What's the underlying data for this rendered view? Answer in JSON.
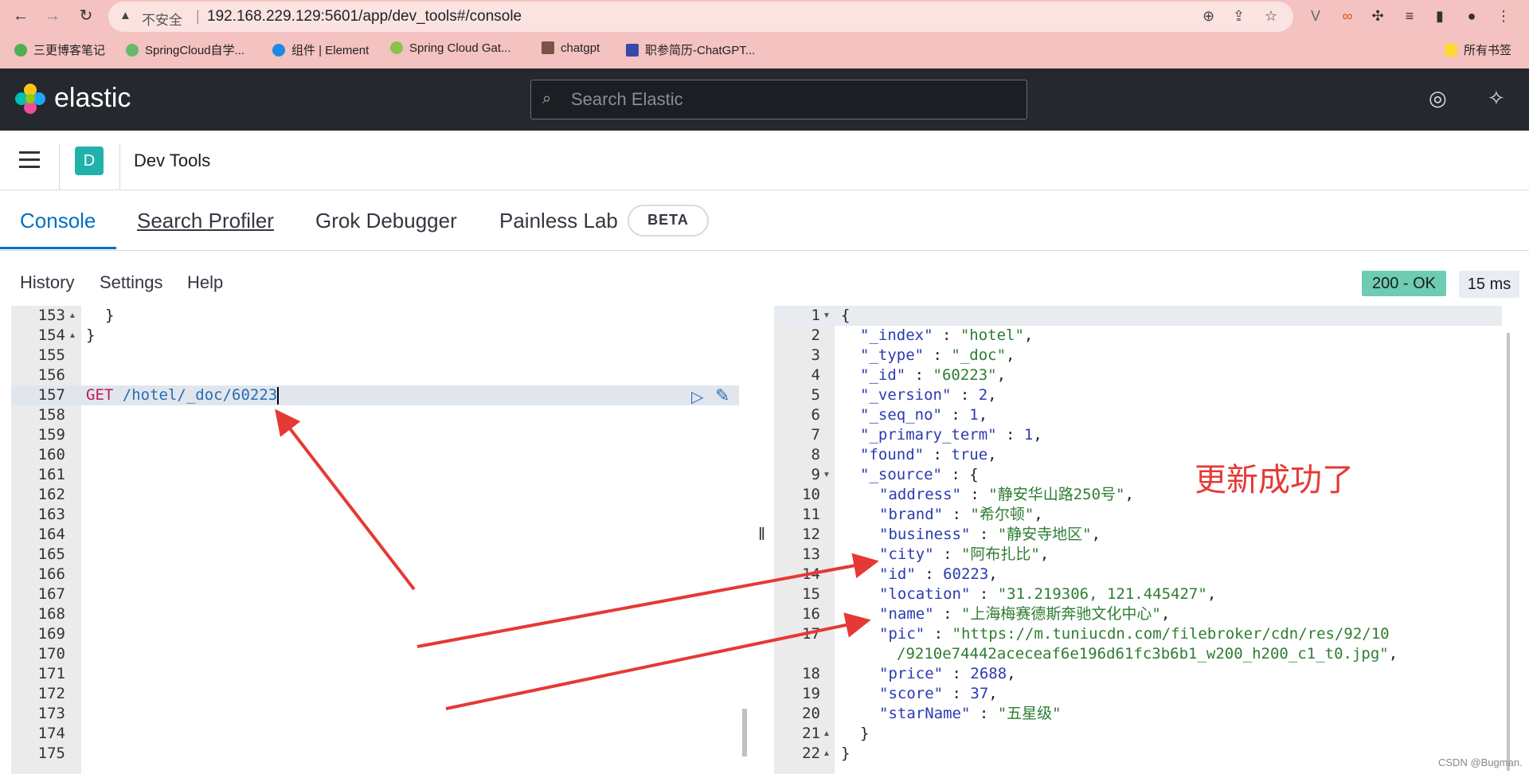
{
  "browser": {
    "insecure_label": "不安全",
    "url": "192.168.229.129:5601/app/dev_tools#/console",
    "bookmarks": [
      "三更博客笔记",
      "SpringCloud自学...",
      "组件 | Element",
      "Spring Cloud Gat...",
      "chatgpt",
      "职参简历-ChatGPT..."
    ],
    "all_bookmarks": "所有书签"
  },
  "header": {
    "brand": "elastic",
    "search_placeholder": "Search Elastic"
  },
  "breadcrumb": {
    "badge": "D",
    "title": "Dev Tools"
  },
  "tabs": [
    {
      "label": "Console"
    },
    {
      "label": "Search Profiler"
    },
    {
      "label": "Grok Debugger"
    },
    {
      "label": "Painless Lab"
    }
  ],
  "beta": "BETA",
  "submenu": {
    "history": "History",
    "settings": "Settings",
    "help": "Help"
  },
  "status": {
    "code": "200 - OK",
    "time": "15 ms"
  },
  "request": {
    "line_numbers": [
      "153",
      "154",
      "155",
      "156",
      "157",
      "158",
      "159",
      "160",
      "161",
      "162",
      "163",
      "164",
      "165",
      "166",
      "167",
      "168",
      "169",
      "170",
      "171",
      "172",
      "173",
      "174",
      "175"
    ],
    "brace1": "}",
    "brace2": "}",
    "method": "GET",
    "path": "/hotel/_doc/60223"
  },
  "response": {
    "line_numbers": [
      "1",
      "2",
      "3",
      "4",
      "5",
      "6",
      "7",
      "8",
      "9",
      "10",
      "11",
      "12",
      "13",
      "14",
      "15",
      "16",
      "17",
      "18",
      "19",
      "20",
      "21",
      "22"
    ],
    "open": "{",
    "close": "}",
    "index_key": "\"_index\"",
    "index_val": "\"hotel\"",
    "type_key": "\"_type\"",
    "type_val": "\"_doc\"",
    "id_key": "\"_id\"",
    "id_val": "\"60223\"",
    "version_key": "\"_version\"",
    "version_val": "2",
    "seq_key": "\"_seq_no\"",
    "seq_val": "1",
    "primary_key": "\"_primary_term\"",
    "primary_val": "1",
    "found_key": "\"found\"",
    "found_val": "true",
    "source_key": "\"_source\"",
    "address_key": "\"address\"",
    "address_val": "\"静安华山路250号\"",
    "brand_key": "\"brand\"",
    "brand_val": "\"希尔顿\"",
    "business_key": "\"business\"",
    "business_val": "\"静安寺地区\"",
    "city_key": "\"city\"",
    "city_val": "\"阿布扎比\"",
    "sid_key": "\"id\"",
    "sid_val": "60223",
    "location_key": "\"location\"",
    "location_val": "\"31.219306, 121.445427\"",
    "name_key": "\"name\"",
    "name_val": "\"上海梅赛德斯奔驰文化中心\"",
    "pic_key": "\"pic\"",
    "pic_val1": "\"https://m.tuniucdn.com/filebroker/cdn/res/92/10",
    "pic_val2": "/9210e74442aceceaf6e196d61fc3b6b1_w200_h200_c1_t0.jpg\"",
    "price_key": "\"price\"",
    "price_val": "2688",
    "score_key": "\"score\"",
    "score_val": "37",
    "star_key": "\"starName\"",
    "star_val": "\"五星级\""
  },
  "annotation": "更新成功了",
  "watermark": "CSDN @Bugman."
}
